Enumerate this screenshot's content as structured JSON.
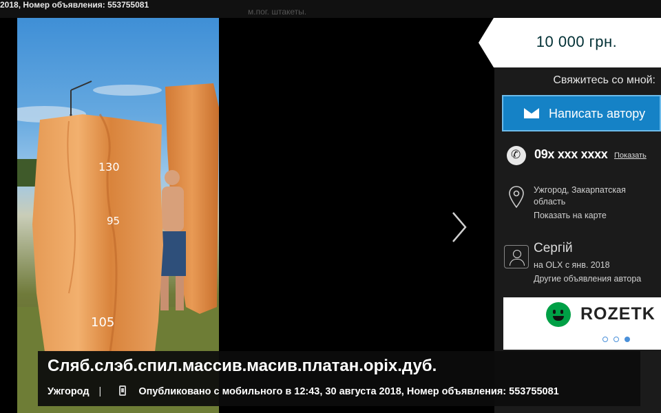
{
  "topbar": {
    "meta": "2018, Номер объявления: 553755081",
    "ghost": "м.пог. штакеты."
  },
  "price": "10 000 грн.",
  "contact": {
    "title": "Свяжитесь со мной:",
    "write_button": "Написать автору",
    "phone": "09x xxx xxxx",
    "phone_show": "Показать"
  },
  "location": {
    "text": "Ужгород, Закарпатская область",
    "map_link": "Показать на карте"
  },
  "user": {
    "name": "Сергій",
    "since": "на OLX с янв. 2018",
    "other_ads": "Другие объявления автора"
  },
  "ad": {
    "brand": "ROZETK"
  },
  "listing": {
    "title": "Сляб.слэб.спил.массив.масив.платан.оріх.дуб.",
    "city": "Ужгород",
    "published": "Опубликовано с мобильного в 12:43, 30 августа 2018, Номер объявления: 553755081"
  },
  "icons": [
    "envelope-icon",
    "phone-icon",
    "location-pin-icon",
    "user-icon",
    "chevron-right-icon",
    "mobile-icon"
  ],
  "colors": {
    "button_blue": "#1582c6",
    "price_text": "#002f34",
    "ad_green": "#00a046"
  }
}
